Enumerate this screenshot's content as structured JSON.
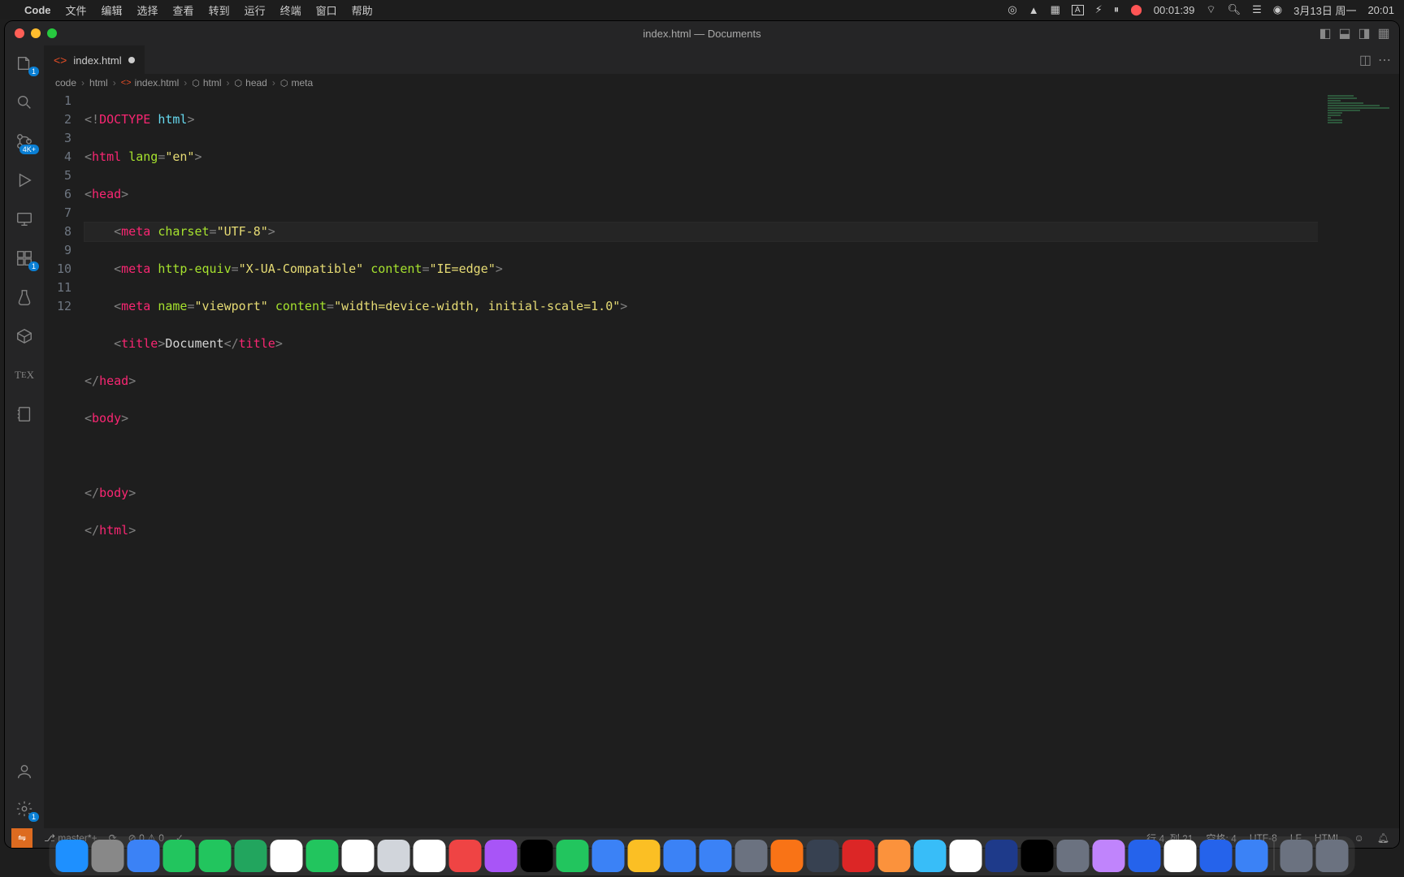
{
  "menubar": {
    "app": "Code",
    "items": [
      "文件",
      "编辑",
      "选择",
      "查看",
      "转到",
      "运行",
      "终端",
      "窗口",
      "帮助"
    ],
    "right": {
      "timer": "00:01:39",
      "date": "3月13日 周一",
      "time": "20:01"
    }
  },
  "window": {
    "title": "index.html — Documents"
  },
  "tab": {
    "filename": "index.html"
  },
  "breadcrumb": {
    "parts": [
      "code",
      "html",
      "index.html",
      "html",
      "head",
      "meta"
    ]
  },
  "activity": {
    "explorer_badge": "1",
    "scm_badge": "4K+",
    "ext_badge": "1",
    "settings_badge": "1"
  },
  "code": {
    "lines": [
      "1",
      "2",
      "3",
      "4",
      "5",
      "6",
      "7",
      "8",
      "9",
      "10",
      "11",
      "12"
    ],
    "doctype_kw": "DOCTYPE",
    "doctype_html": "html",
    "html_tag": "html",
    "lang_attr": "lang",
    "lang_val": "\"en\"",
    "head_tag": "head",
    "meta_tag": "meta",
    "charset_attr": "charset",
    "charset_val": "\"UTF-8\"",
    "httpequiv_attr": "http-equiv",
    "httpequiv_val": "\"X-UA-Compatible\"",
    "content_attr": "content",
    "content_val1": "\"IE=edge\"",
    "name_attr": "name",
    "name_val": "\"viewport\"",
    "content_val2": "\"width=device-width, initial-scale=1.0\"",
    "title_tag": "title",
    "title_text": "Document",
    "body_tag": "body"
  },
  "statusbar": {
    "branch": "master*+",
    "errors": "0",
    "warnings": "0",
    "cursor": "行 4, 列 21",
    "spaces": "空格: 4",
    "encoding": "UTF-8",
    "eol": "LF",
    "lang": "HTML"
  },
  "dock": {
    "items": [
      {
        "name": "finder",
        "bg": "#1e90ff"
      },
      {
        "name": "launchpad",
        "bg": "#888"
      },
      {
        "name": "mail",
        "bg": "#3b82f6"
      },
      {
        "name": "messages",
        "bg": "#22c55e"
      },
      {
        "name": "wechat",
        "bg": "#22c55e"
      },
      {
        "name": "maps",
        "bg": "#22a55e"
      },
      {
        "name": "photos",
        "bg": "#fff"
      },
      {
        "name": "facetime",
        "bg": "#22c55e"
      },
      {
        "name": "calendar",
        "bg": "#fff"
      },
      {
        "name": "contacts",
        "bg": "#d1d5db"
      },
      {
        "name": "reminders",
        "bg": "#fff"
      },
      {
        "name": "music",
        "bg": "#ef4444"
      },
      {
        "name": "podcasts",
        "bg": "#a855f7"
      },
      {
        "name": "tv",
        "bg": "#000"
      },
      {
        "name": "numbers",
        "bg": "#22c55e"
      },
      {
        "name": "keynote",
        "bg": "#3b82f6"
      },
      {
        "name": "notes",
        "bg": "#fbbf24"
      },
      {
        "name": "appstore",
        "bg": "#3b82f6"
      },
      {
        "name": "safari",
        "bg": "#3b82f6"
      },
      {
        "name": "settings",
        "bg": "#6b7280"
      },
      {
        "name": "vlc",
        "bg": "#f97316"
      },
      {
        "name": "balance",
        "bg": "#374151"
      },
      {
        "name": "acrobat",
        "bg": "#dc2626"
      },
      {
        "name": "books",
        "bg": "#fb923c"
      },
      {
        "name": "telegram",
        "bg": "#38bdf8"
      },
      {
        "name": "tex",
        "bg": "#fff"
      },
      {
        "name": "photoshop",
        "bg": "#1e3a8a"
      },
      {
        "name": "terminal",
        "bg": "#000"
      },
      {
        "name": "misc",
        "bg": "#6b7280"
      },
      {
        "name": "vscode2",
        "bg": "#c084fc"
      },
      {
        "name": "vscode",
        "bg": "#2563eb"
      },
      {
        "name": "chrome",
        "bg": "#fff"
      },
      {
        "name": "word",
        "bg": "#2563eb"
      },
      {
        "name": "finder2",
        "bg": "#3b82f6"
      },
      {
        "name": "downloads",
        "bg": "#6b7280"
      },
      {
        "name": "trash",
        "bg": "#6b7280"
      }
    ]
  }
}
